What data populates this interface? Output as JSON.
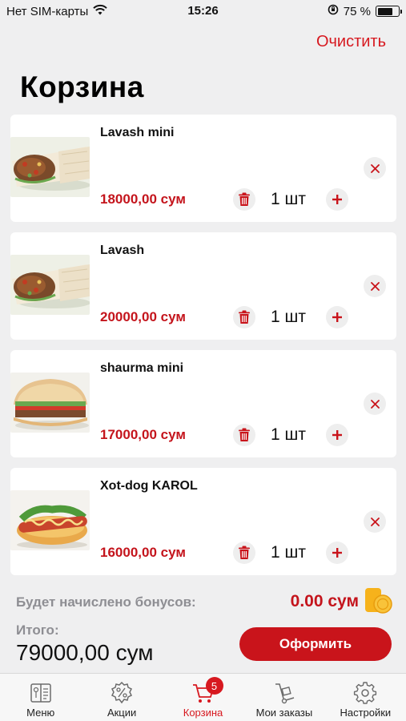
{
  "status_bar": {
    "carrier": "Нет SIM-карты",
    "time": "15:26",
    "battery_percent": "75 %",
    "battery_level": 0.75
  },
  "header": {
    "clear_label": "Очистить",
    "title": "Корзина"
  },
  "cart": {
    "items": [
      {
        "name": "Lavash mini",
        "price": "18000,00 сум",
        "quantity": "1 шт",
        "image": "lavash-wrap"
      },
      {
        "name": "Lavash",
        "price": "20000,00 сум",
        "quantity": "1 шт",
        "image": "lavash-wrap"
      },
      {
        "name": "shaurma mini",
        "price": "17000,00 сум",
        "quantity": "1 шт",
        "image": "shaurma-pita"
      },
      {
        "name": "Xot-dog KAROL",
        "price": "16000,00 сум",
        "quantity": "1 шт",
        "image": "hot-dog"
      }
    ]
  },
  "summary": {
    "bonus_label": "Будет начислено бонусов:",
    "bonus_value": "0.00 сум",
    "total_label": "Итого:",
    "total_value": "79000,00 сум",
    "checkout_label": "Оформить"
  },
  "tab_bar": {
    "tabs": [
      {
        "label": "Меню",
        "icon": "menu-book-icon",
        "active": false
      },
      {
        "label": "Акции",
        "icon": "discount-badge-icon",
        "active": false
      },
      {
        "label": "Корзина",
        "icon": "cart-icon",
        "active": true,
        "badge": "5"
      },
      {
        "label": "Мои заказы",
        "icon": "hand-truck-icon",
        "active": false
      },
      {
        "label": "Настройки",
        "icon": "gear-icon",
        "active": false
      }
    ]
  },
  "colors": {
    "accent": "#d71920",
    "price": "#c4141c",
    "background": "#efeff0"
  }
}
